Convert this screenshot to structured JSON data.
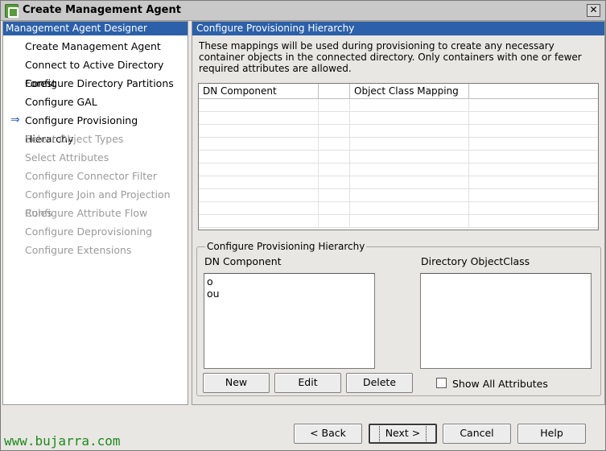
{
  "window": {
    "title": "Create Management Agent",
    "close_glyph": "✕"
  },
  "left_pane": {
    "header": "Management Agent Designer",
    "current_indicator": "⇒",
    "items": [
      {
        "label": "Create Management Agent",
        "enabled": true,
        "current": false
      },
      {
        "label": "Connect to Active Directory Forest",
        "enabled": true,
        "current": false
      },
      {
        "label": "Configure Directory Partitions",
        "enabled": true,
        "current": false
      },
      {
        "label": "Configure GAL",
        "enabled": true,
        "current": false
      },
      {
        "label": "Configure Provisioning Hierarchy",
        "enabled": true,
        "current": true
      },
      {
        "label": "Select Object Types",
        "enabled": false,
        "current": false
      },
      {
        "label": "Select Attributes",
        "enabled": false,
        "current": false
      },
      {
        "label": "Configure Connector Filter",
        "enabled": false,
        "current": false
      },
      {
        "label": "Configure Join and Projection Rules",
        "enabled": false,
        "current": false
      },
      {
        "label": "Configure Attribute Flow",
        "enabled": false,
        "current": false
      },
      {
        "label": "Configure Deprovisioning",
        "enabled": false,
        "current": false
      },
      {
        "label": "Configure Extensions",
        "enabled": false,
        "current": false
      }
    ]
  },
  "right_pane": {
    "header": "Configure Provisioning Hierarchy",
    "description": "These mappings will be used during provisioning to create any necessary container objects in the connected directory.  Only containers with one or fewer required attributes are allowed.",
    "grid": {
      "columns": [
        "DN Component",
        "",
        "Object Class Mapping",
        ""
      ],
      "rows": []
    },
    "group": {
      "title": "Configure Provisioning Hierarchy",
      "dn_label": "DN Component",
      "dn_items": [
        "o",
        "ou"
      ],
      "objclass_label": "Directory ObjectClass",
      "objclass_items": [],
      "new_label": "New",
      "edit_label": "Edit",
      "delete_label": "Delete",
      "show_all_label": "Show All Attributes",
      "show_all_checked": false
    }
  },
  "footer": {
    "back_label": "< Back",
    "next_label": "Next >",
    "cancel_label": "Cancel",
    "help_label": "Help",
    "watermark": "www.bujarra.com"
  },
  "colors": {
    "header_blue": "#2c60a8",
    "watermark_green": "#1d8a1d"
  }
}
